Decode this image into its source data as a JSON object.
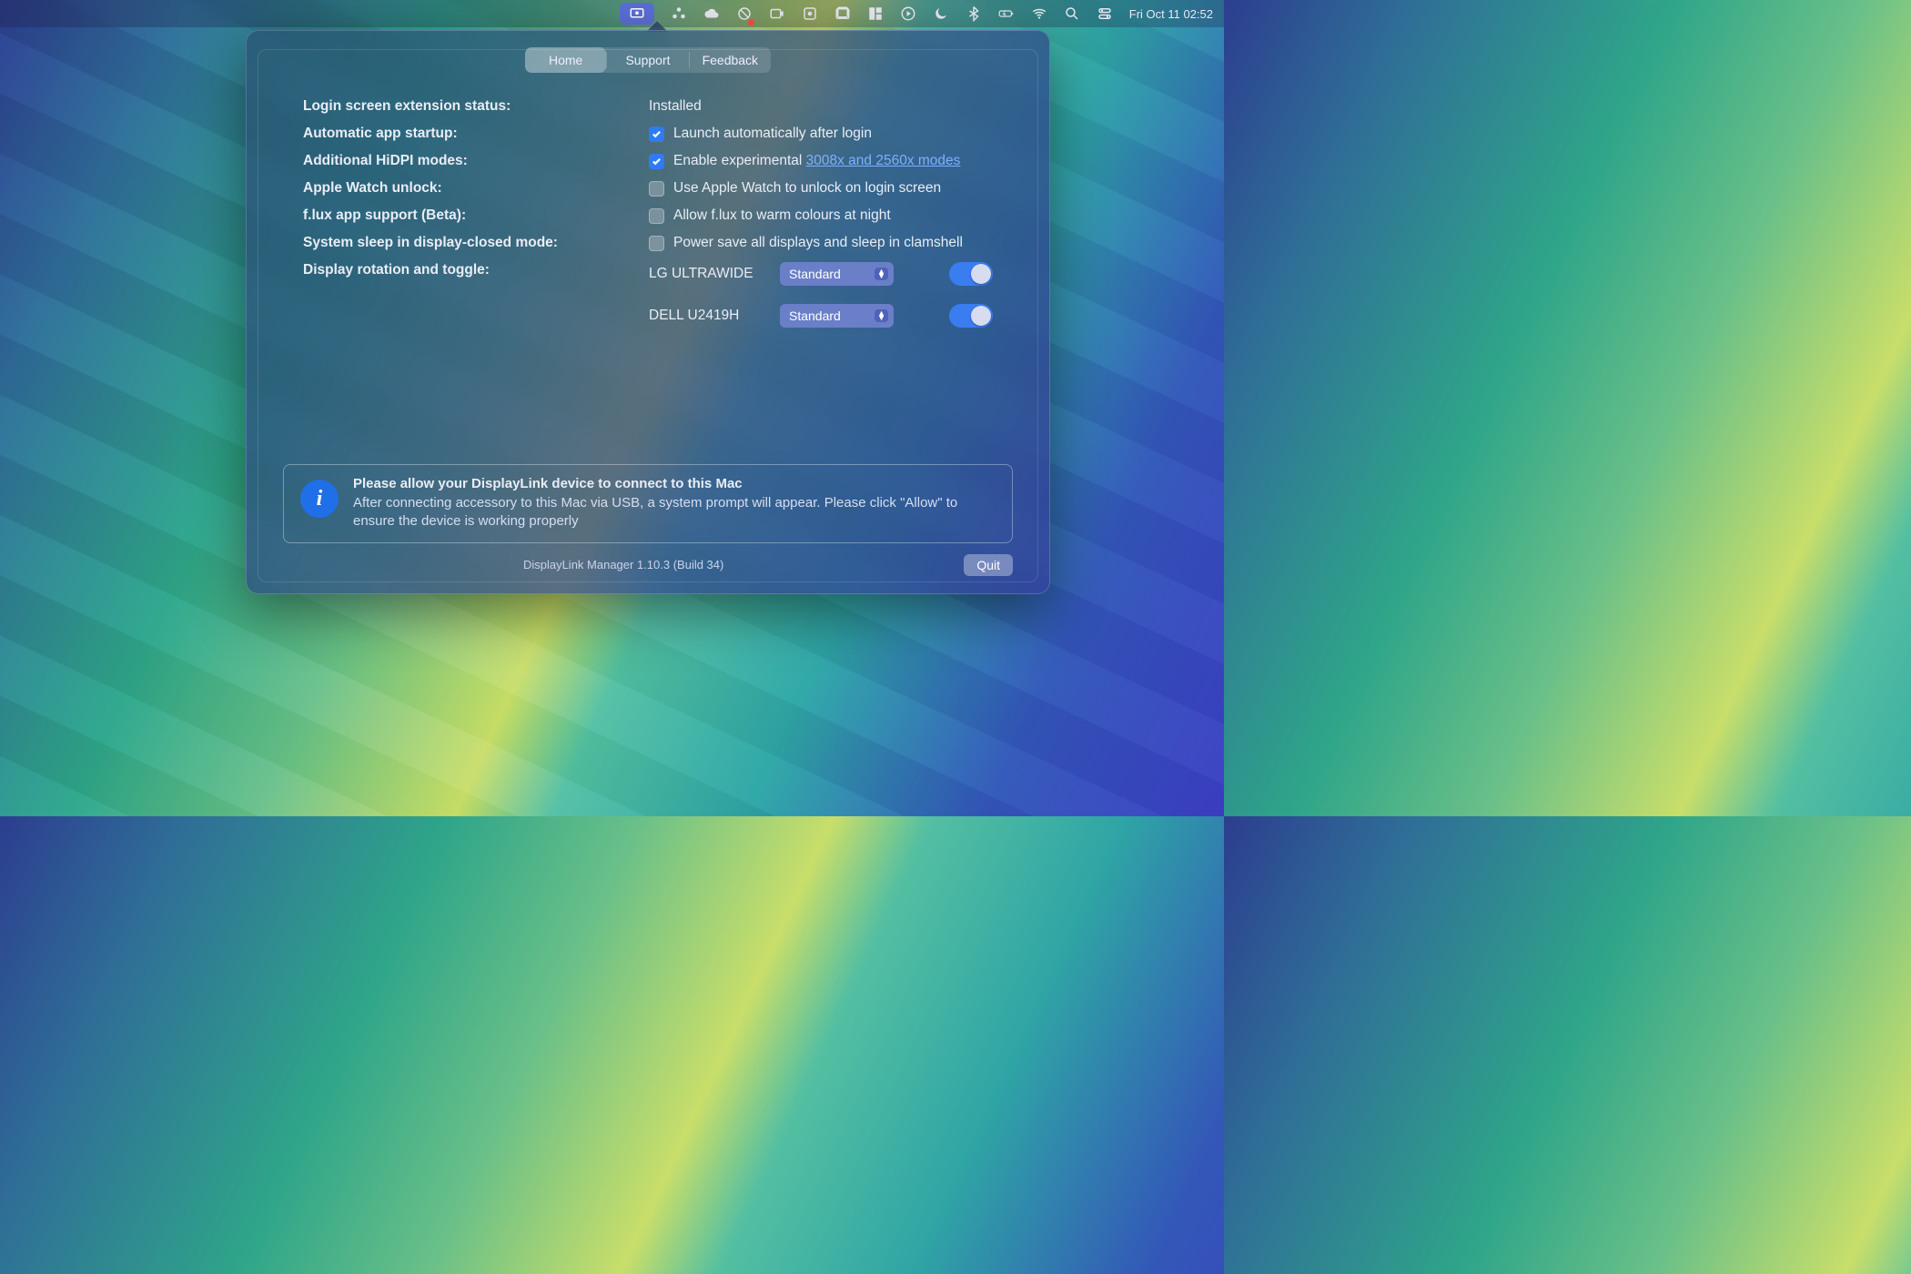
{
  "menubar": {
    "clock": "Fri Oct 11  02:52"
  },
  "tabs": {
    "home": "Home",
    "support": "Support",
    "feedback": "Feedback"
  },
  "settings": {
    "login_status_label": "Login screen extension status:",
    "login_status_value": "Installed",
    "auto_startup_label": "Automatic app startup:",
    "auto_startup_text": "Launch automatically after login",
    "hidpi_label": "Additional HiDPI modes:",
    "hidpi_text_prefix": "Enable experimental ",
    "hidpi_link": "3008x and 2560x modes",
    "watch_label": "Apple Watch unlock:",
    "watch_text": "Use Apple Watch to unlock on login screen",
    "flux_label": "f.lux app support (Beta):",
    "flux_text": "Allow f.lux to warm colours at night",
    "sleep_label": "System sleep in display-closed mode:",
    "sleep_text": "Power save all displays and sleep in clamshell",
    "rotation_label": "Display rotation and toggle:"
  },
  "displays": [
    {
      "name": "LG ULTRAWIDE",
      "mode": "Standard"
    },
    {
      "name": "DELL U2419H",
      "mode": "Standard"
    }
  ],
  "info": {
    "title": "Please allow your DisplayLink device to connect to this Mac",
    "body": "After connecting accessory to this Mac via USB, a system prompt will appear. Please click \"Allow\" to ensure the device is working properly"
  },
  "footer": {
    "version": "DisplayLink Manager 1.10.3 (Build 34)",
    "quit": "Quit"
  }
}
